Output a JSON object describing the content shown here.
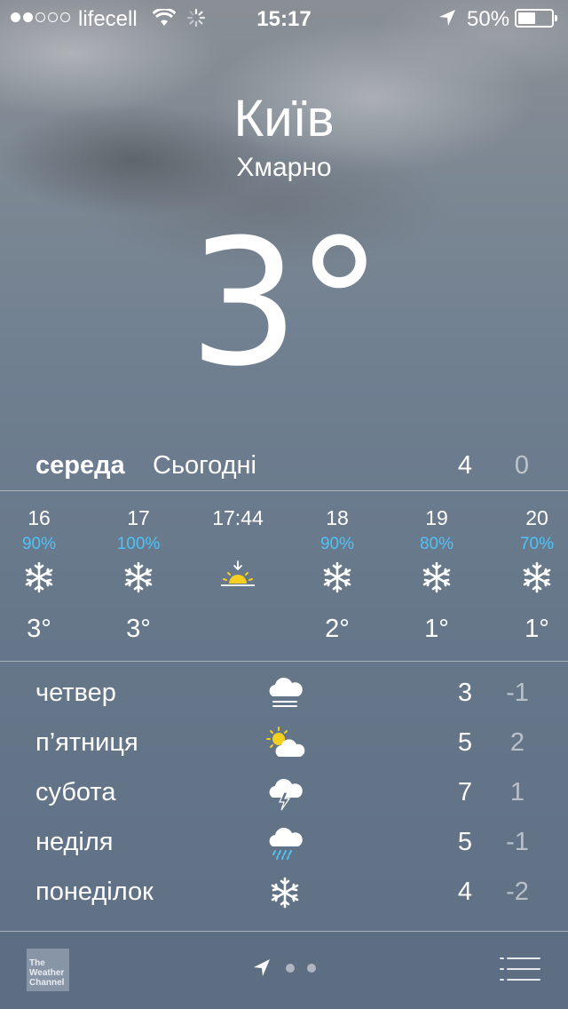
{
  "status_bar": {
    "carrier": "lifecell",
    "time": "15:17",
    "battery": "50%",
    "signal_bars": 2,
    "signal_total": 5,
    "battery_level": 0.5
  },
  "current": {
    "city": "Київ",
    "condition": "Хмарно",
    "temperature": "3",
    "degree": "°"
  },
  "today": {
    "day": "середа",
    "label": "Сьогодні",
    "high": "4",
    "low": "0"
  },
  "hourly": [
    {
      "hour": "16",
      "precip": "90%",
      "icon": "snow-icon",
      "temp": "3°"
    },
    {
      "hour": "17",
      "precip": "100%",
      "icon": "snow-icon",
      "temp": "3°"
    },
    {
      "hour": "17:44",
      "precip": "",
      "icon": "sunset-icon",
      "temp": ""
    },
    {
      "hour": "18",
      "precip": "90%",
      "icon": "snow-icon",
      "temp": "2°"
    },
    {
      "hour": "19",
      "precip": "80%",
      "icon": "snow-icon",
      "temp": "1°"
    },
    {
      "hour": "20",
      "precip": "70%",
      "icon": "snow-icon",
      "temp": "1°"
    }
  ],
  "daily": [
    {
      "day": "четвер",
      "icon": "fog-icon",
      "high": "3",
      "low": "-1"
    },
    {
      "day": "п’ятниця",
      "icon": "partly-cloudy-icon",
      "high": "5",
      "low": "2"
    },
    {
      "day": "субота",
      "icon": "thunderstorm-icon",
      "high": "7",
      "low": "1"
    },
    {
      "day": "неділя",
      "icon": "rain-icon",
      "high": "5",
      "low": "-1"
    },
    {
      "day": "понеділок",
      "icon": "snow-icon",
      "high": "4",
      "low": "-2"
    }
  ],
  "toolbar": {
    "logo_text": [
      "The",
      "Weather",
      "Channel"
    ],
    "pages": 2
  },
  "colors": {
    "precip": "#4fc3f7",
    "sun": "#f5d020",
    "background": "#66778a"
  }
}
